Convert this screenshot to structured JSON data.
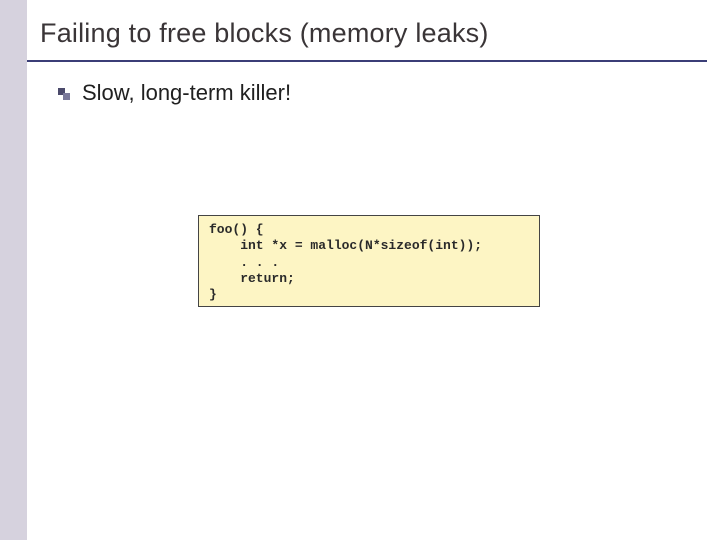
{
  "title": "Failing to free blocks (memory leaks)",
  "bullet": "Slow, long-term killer!",
  "code": {
    "l1": "foo() {",
    "l2": "    int *x = malloc(N*sizeof(int));",
    "l3": "    . . .",
    "l4": "    return;",
    "l5": "}"
  }
}
